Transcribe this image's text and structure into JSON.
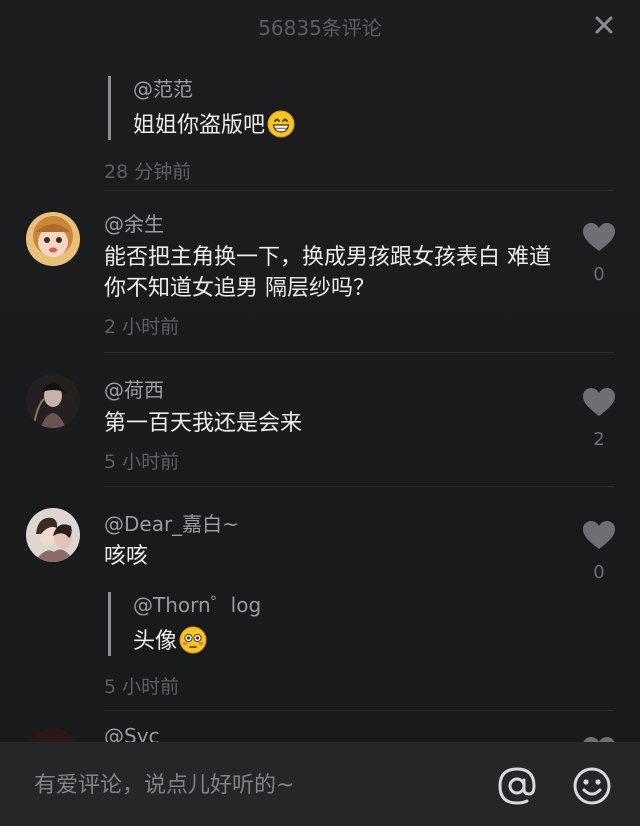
{
  "header": {
    "title": "56835条评论"
  },
  "top_reply": {
    "user": "@范范",
    "text": "姐姐你盗版吧",
    "emoji": "grinning-face",
    "time": "28 分钟前"
  },
  "comments": [
    {
      "user": "@余生",
      "text": "能否把主角换一下，换成男孩跟女孩表白 难道你不知道女追男 隔层纱吗？",
      "time": "2 小时前",
      "likes": "0",
      "avatar_color": "#d8a66a"
    },
    {
      "user": "@荷西",
      "text": "第一百天我还是会来",
      "time": "5 小时前",
      "likes": "2",
      "avatar_color": "#3a2f33"
    },
    {
      "user": "@Dear_嘉白~",
      "text": "咳咳",
      "time": "5 小时前",
      "likes": "0",
      "avatar_color": "#cfc8c6",
      "reply": {
        "user": "@Thorn゜log",
        "text": "头像",
        "emoji": "flushed-face"
      }
    },
    {
      "user": "@Syc",
      "avatar_color": "#3a1e1e"
    }
  ],
  "input": {
    "placeholder": "有爱评论，说点儿好听的~"
  },
  "icons": {
    "close": "close-icon",
    "like": "heart-icon",
    "mention": "at-icon",
    "emoji": "smiley-icon"
  },
  "colors": {
    "background": "#1a1b1d",
    "bottom_bar": "#252628",
    "primary_text": "#ececef",
    "secondary_text": "#9a9ba0",
    "heart": "#6e6f74"
  }
}
